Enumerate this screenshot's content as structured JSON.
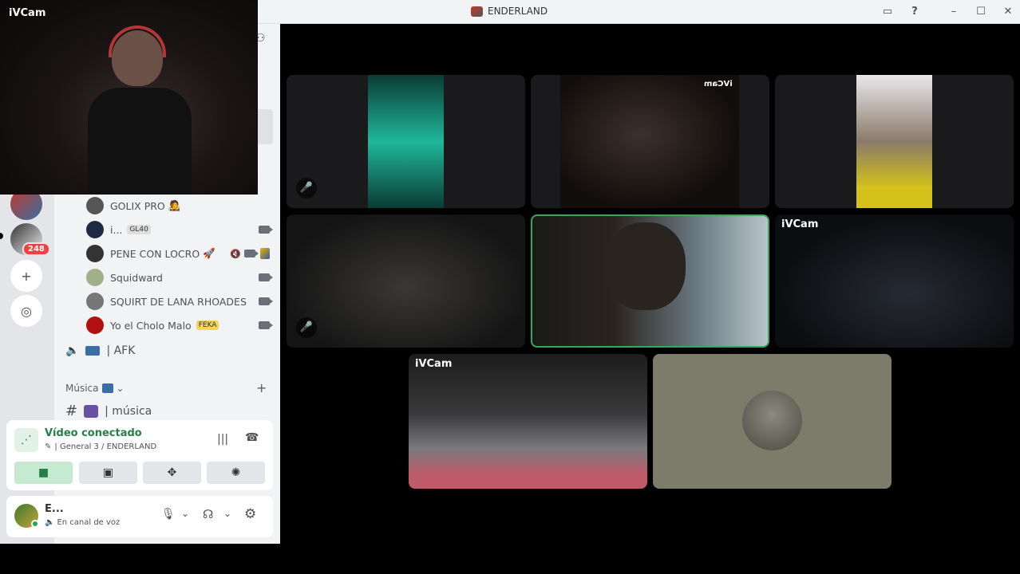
{
  "window": {
    "title": "ENDERLAND"
  },
  "pip": {
    "label": "iVCam"
  },
  "servers": {
    "badge_count": "248"
  },
  "channel_users": [
    {
      "name": "GOLIX PRO",
      "emoji": "🧑‍🎤",
      "color": "#555"
    },
    {
      "name": "i...",
      "tag": "GL40",
      "color": "#1f2a44"
    },
    {
      "name": "PENE CON LOCRO",
      "emoji": "🚀",
      "color": "#333"
    },
    {
      "name": "Squidward",
      "color": "#a0b08a"
    },
    {
      "name": "SQUIRT DE LANA RHOADES",
      "color": "#777"
    },
    {
      "name": "Yo el Cholo Malo",
      "tag": "FEKA",
      "color": "#b01010"
    }
  ],
  "afk_channel": {
    "label": "| AFK"
  },
  "category": {
    "label": "Música"
  },
  "music_channel": {
    "label": "| música"
  },
  "voice": {
    "status": "Vídeo conectado",
    "location": "| General 3 / ENDERLAND"
  },
  "user": {
    "name": "E...",
    "status": "En canal de voz"
  },
  "tiles": [
    {
      "label": "",
      "muted": true
    },
    {
      "label": "iVCam",
      "muted": false
    },
    {
      "label": "",
      "muted": false
    },
    {
      "label": "",
      "muted": true
    },
    {
      "label": "",
      "muted": false
    },
    {
      "label": "iVCam",
      "muted": false
    },
    {
      "label": "iVCam",
      "muted": false
    },
    {
      "label": "",
      "muted": false
    }
  ],
  "colors": {
    "connected_green": "#248046",
    "speaking_border": "#3ba55c"
  }
}
